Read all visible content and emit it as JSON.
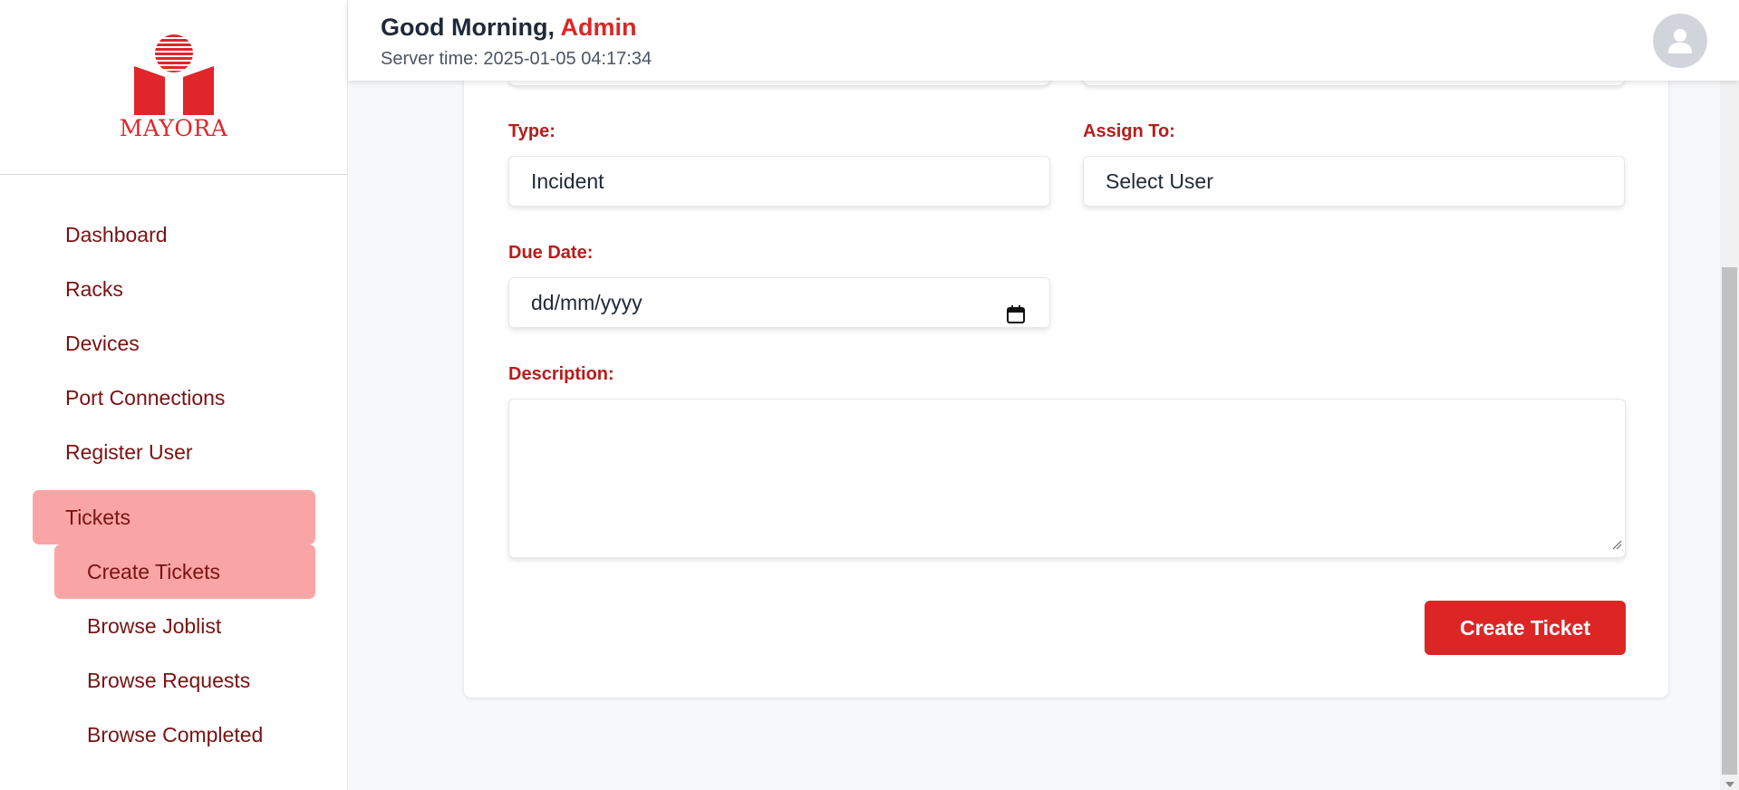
{
  "brand": {
    "logo_text": "MAYORA",
    "accent": "#dc2626"
  },
  "header": {
    "greeting_prefix": "Good Morning, ",
    "user_name": "Admin",
    "server_time": "Server time: 2025-01-05 04:17:34",
    "avatar_icon": "user-icon"
  },
  "sidebar": {
    "items": [
      {
        "label": "Dashboard"
      },
      {
        "label": "Racks"
      },
      {
        "label": "Devices"
      },
      {
        "label": "Port Connections"
      },
      {
        "label": "Register User"
      }
    ],
    "tickets": {
      "label": "Tickets",
      "sub_items": [
        {
          "label": "Create Tickets",
          "active": true
        },
        {
          "label": "Browse Joblist"
        },
        {
          "label": "Browse Requests"
        },
        {
          "label": "Browse Completed"
        }
      ]
    }
  },
  "form": {
    "type_label": "Type:",
    "type_value": "Incident",
    "assign_label": "Assign To:",
    "assign_value": "Select User",
    "due_label": "Due Date:",
    "due_placeholder": "dd/mm/yyyy",
    "description_label": "Description:",
    "submit_label": "Create Ticket"
  }
}
